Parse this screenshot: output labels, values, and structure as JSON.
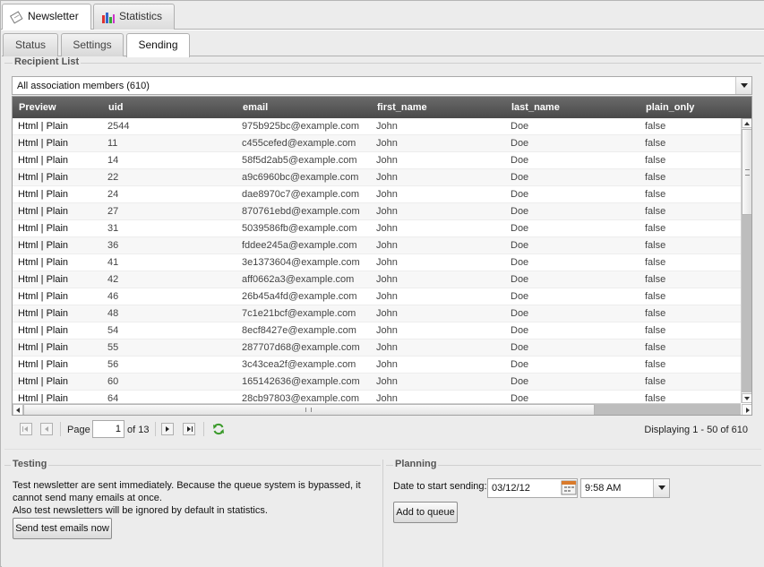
{
  "top_tabs": [
    {
      "label": "Newsletter",
      "icon": "newsletter-icon"
    },
    {
      "label": "Statistics",
      "icon": "bar-chart-icon"
    }
  ],
  "sub_tabs": [
    "Status",
    "Settings",
    "Sending"
  ],
  "recipient_list": {
    "title": "Recipient List",
    "selected_list": "All association members (610)",
    "columns": [
      "Preview",
      "uid",
      "email",
      "first_name",
      "last_name",
      "plain_only"
    ],
    "rows": [
      {
        "preview": "Html | Plain",
        "uid": "2544",
        "email": "975b925bc@example.com",
        "first_name": "John",
        "last_name": "Doe",
        "plain_only": "false"
      },
      {
        "preview": "Html | Plain",
        "uid": "11",
        "email": "c455cefed@example.com",
        "first_name": "John",
        "last_name": "Doe",
        "plain_only": "false"
      },
      {
        "preview": "Html | Plain",
        "uid": "14",
        "email": "58f5d2ab5@example.com",
        "first_name": "John",
        "last_name": "Doe",
        "plain_only": "false"
      },
      {
        "preview": "Html | Plain",
        "uid": "22",
        "email": "a9c6960bc@example.com",
        "first_name": "John",
        "last_name": "Doe",
        "plain_only": "false"
      },
      {
        "preview": "Html | Plain",
        "uid": "24",
        "email": "dae8970c7@example.com",
        "first_name": "John",
        "last_name": "Doe",
        "plain_only": "false"
      },
      {
        "preview": "Html | Plain",
        "uid": "27",
        "email": "870761ebd@example.com",
        "first_name": "John",
        "last_name": "Doe",
        "plain_only": "false"
      },
      {
        "preview": "Html | Plain",
        "uid": "31",
        "email": "5039586fb@example.com",
        "first_name": "John",
        "last_name": "Doe",
        "plain_only": "false"
      },
      {
        "preview": "Html | Plain",
        "uid": "36",
        "email": "fddee245a@example.com",
        "first_name": "John",
        "last_name": "Doe",
        "plain_only": "false"
      },
      {
        "preview": "Html | Plain",
        "uid": "41",
        "email": "3e1373604@example.com",
        "first_name": "John",
        "last_name": "Doe",
        "plain_only": "false"
      },
      {
        "preview": "Html | Plain",
        "uid": "42",
        "email": "aff0662a3@example.com",
        "first_name": "John",
        "last_name": "Doe",
        "plain_only": "false"
      },
      {
        "preview": "Html | Plain",
        "uid": "46",
        "email": "26b45a4fd@example.com",
        "first_name": "John",
        "last_name": "Doe",
        "plain_only": "false"
      },
      {
        "preview": "Html | Plain",
        "uid": "48",
        "email": "7c1e21bcf@example.com",
        "first_name": "John",
        "last_name": "Doe",
        "plain_only": "false"
      },
      {
        "preview": "Html | Plain",
        "uid": "54",
        "email": "8ecf8427e@example.com",
        "first_name": "John",
        "last_name": "Doe",
        "plain_only": "false"
      },
      {
        "preview": "Html | Plain",
        "uid": "55",
        "email": "287707d68@example.com",
        "first_name": "John",
        "last_name": "Doe",
        "plain_only": "false"
      },
      {
        "preview": "Html | Plain",
        "uid": "56",
        "email": "3c43cea2f@example.com",
        "first_name": "John",
        "last_name": "Doe",
        "plain_only": "false"
      },
      {
        "preview": "Html | Plain",
        "uid": "60",
        "email": "165142636@example.com",
        "first_name": "John",
        "last_name": "Doe",
        "plain_only": "false"
      },
      {
        "preview": "Html | Plain",
        "uid": "64",
        "email": "28cb97803@example.com",
        "first_name": "John",
        "last_name": "Doe",
        "plain_only": "false"
      }
    ]
  },
  "pager": {
    "page_label": "Page",
    "page_value": "1",
    "of_label": "of 13",
    "displaying": "Displaying 1 - 50 of 610"
  },
  "testing": {
    "title": "Testing",
    "line1": "Test newsletter are sent immediately. Because the queue system is bypassed, it",
    "line2": "cannot send many emails at once.",
    "line3": "Also test newsletters will be ignored by default in statistics.",
    "button": "Send test emails now"
  },
  "planning": {
    "title": "Planning",
    "date_label": "Date to start sending:",
    "date_value": "03/12/12",
    "time_value": "9:58 AM",
    "button": "Add to queue"
  },
  "colors": {
    "header_bg": "#555555",
    "refresh": "#3a9a2a",
    "calendar": "#d97a2b"
  }
}
